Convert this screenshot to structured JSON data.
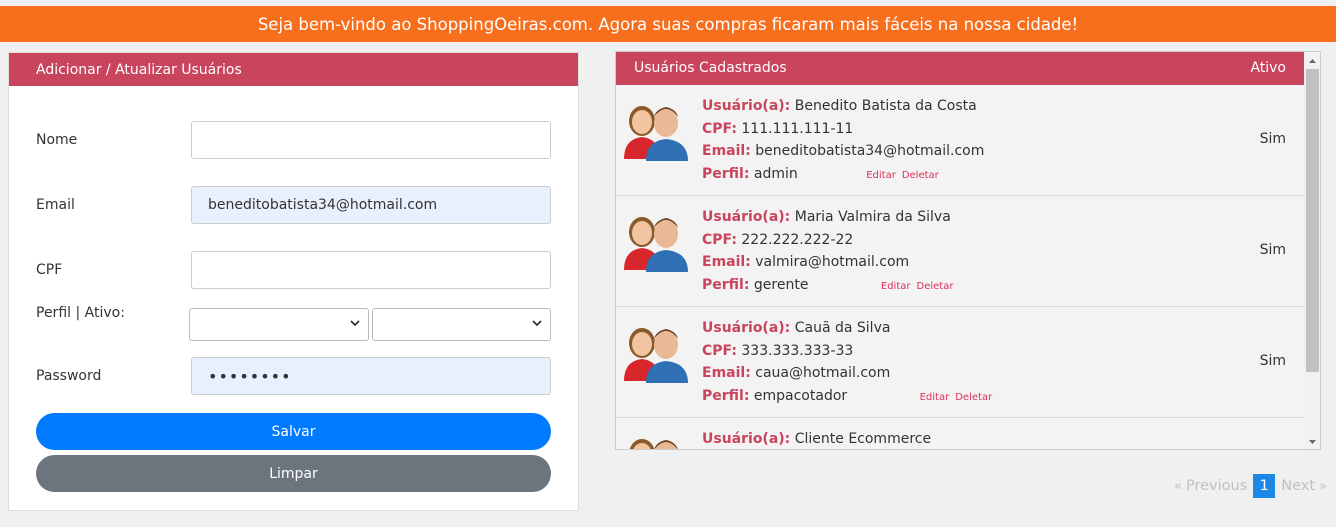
{
  "banner": {
    "text": "Seja bem-vindo ao ShoppingOeiras.com. Agora suas compras ficaram mais fáceis na nossa cidade!"
  },
  "form": {
    "title": "Adicionar / Atualizar Usuários",
    "fields": {
      "nome": {
        "label": "Nome",
        "value": ""
      },
      "email": {
        "label": "Email",
        "value": "beneditobatista34@hotmail.com"
      },
      "cpf": {
        "label": "CPF",
        "value": ""
      },
      "perfil_ativo": {
        "label": "Perfil | Ativo:"
      },
      "password": {
        "label": "Password",
        "value": "••••••••"
      }
    },
    "buttons": {
      "save": "Salvar",
      "clear": "Limpar"
    }
  },
  "list": {
    "title": "Usuários Cadastrados",
    "col_ativo": "Ativo",
    "keys": {
      "usuario": "Usuário(a):",
      "cpf": "CPF:",
      "email": "Email:",
      "perfil": "Perfil:"
    },
    "actions": {
      "edit": "Editar",
      "delete": "Deletar"
    },
    "users": [
      {
        "name": "Benedito Batista da Costa",
        "cpf": "111.111.111-11",
        "email": "beneditobatista34@hotmail.com",
        "perfil": "admin",
        "ativo": "Sim"
      },
      {
        "name": "Maria Valmira da Silva",
        "cpf": "222.222.222-22",
        "email": "valmira@hotmail.com",
        "perfil": "gerente",
        "ativo": "Sim"
      },
      {
        "name": "Cauã da Silva",
        "cpf": "333.333.333-33",
        "email": "caua@hotmail.com",
        "perfil": "empacotador",
        "ativo": "Sim"
      },
      {
        "name": "Cliente Ecommerce"
      }
    ]
  },
  "pagination": {
    "prev_symbol": "«",
    "prev": "Previous",
    "current": "1",
    "next": "Next",
    "next_symbol": "»"
  },
  "colors": {
    "banner": "#f76e1c",
    "header": "#c9445d",
    "primary": "#007bff",
    "secondary": "#6c757d",
    "page_active": "#1e88e5"
  }
}
